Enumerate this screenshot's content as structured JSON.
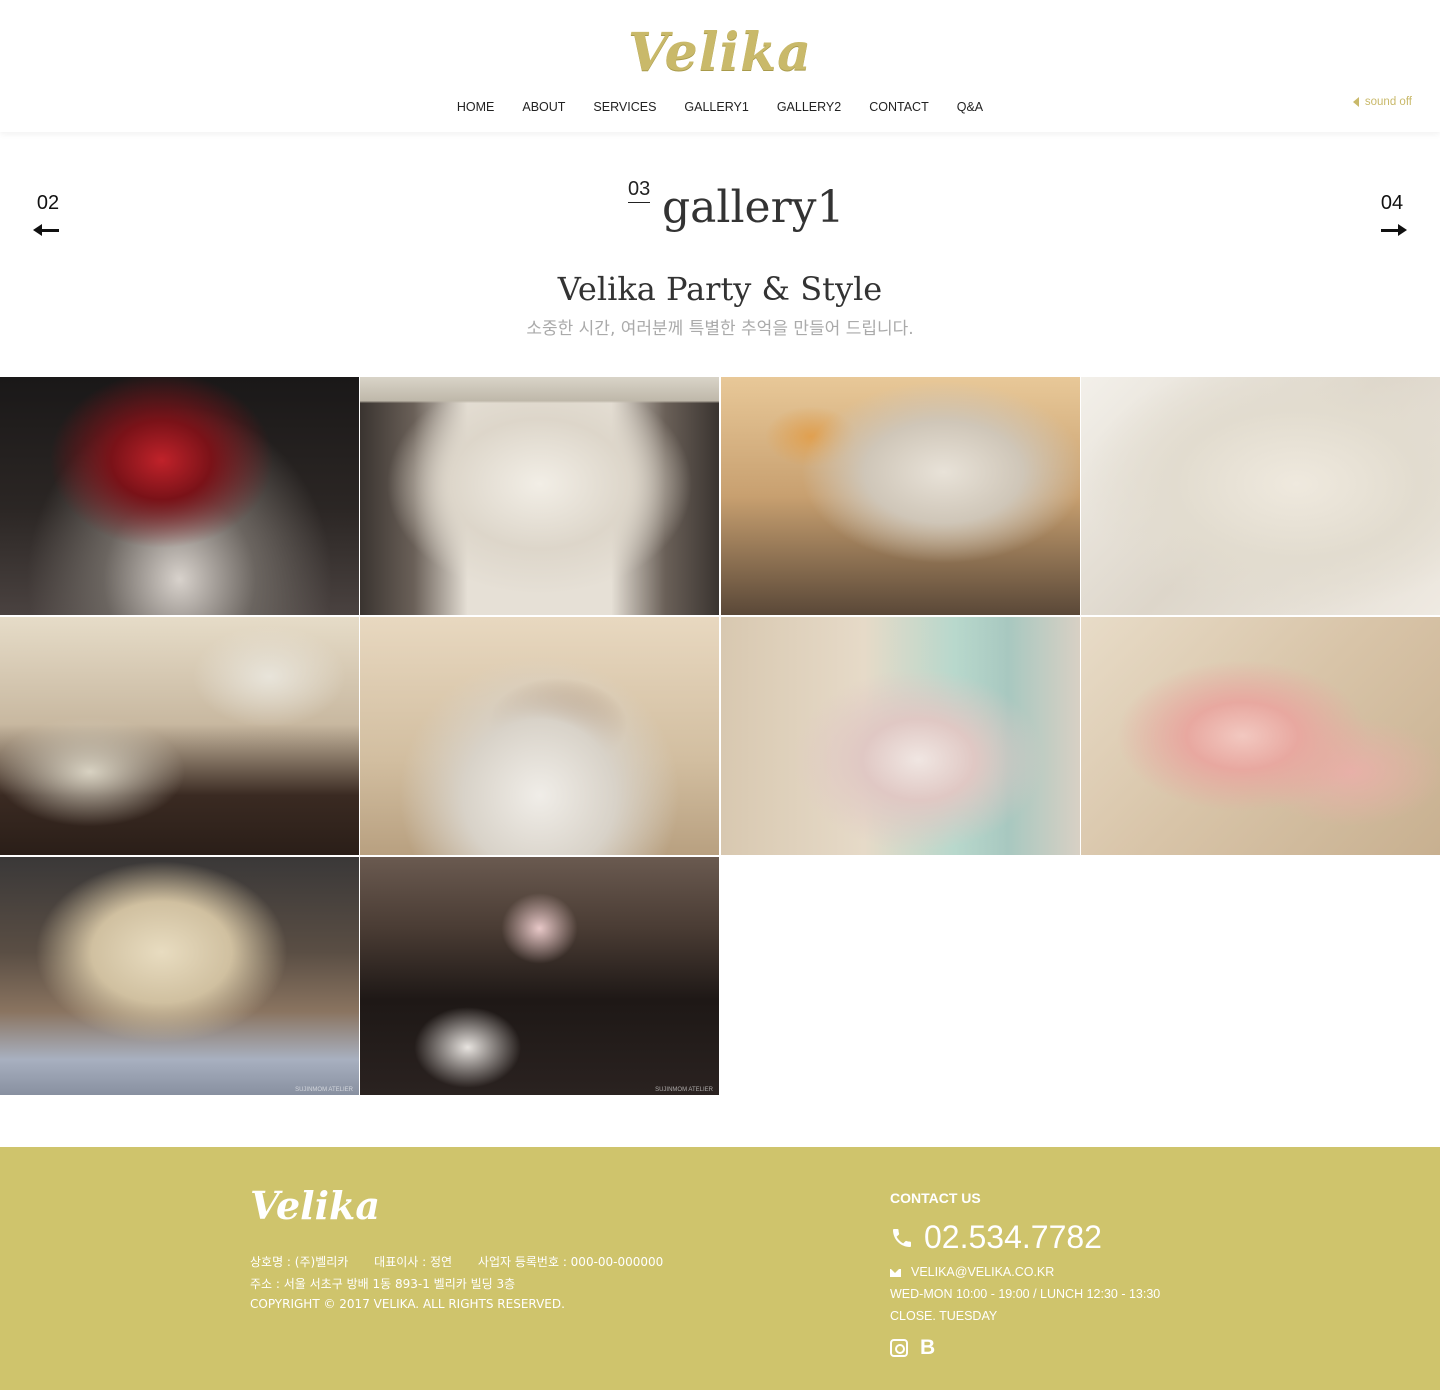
{
  "header": {
    "logo": "Velika",
    "nav": [
      "HOME",
      "ABOUT",
      "SERVICES",
      "GALLERY1",
      "GALLERY2",
      "CONTACT",
      "Q&A"
    ],
    "sound_label": "sound off"
  },
  "page_nav": {
    "prev": "02",
    "next": "04"
  },
  "section": {
    "number": "03",
    "title": "gallery1",
    "subtitle": "Velika Party & Style",
    "description": "소중한 시간, 여러분께 특별한 추억을 만들어 드립니다."
  },
  "gallery": {
    "watermark": "SUJINMOM ATELIER",
    "photos": [
      "Red berry centerpiece on dinner table",
      "White floral stage backdrop with dessert table",
      "Paper flower place card board with frames",
      "Celebrate first birthday paper flower sign",
      "Traditional Korean doljabi table items",
      "Rice cakes and fruit on gold stands",
      "Cherry blossom vase and butterfly candle",
      "Pink cherry blossom branches close-up",
      "Photo frames and folding screen display",
      "Dining tables with pink napkins and candles"
    ]
  },
  "footer": {
    "logo": "Velika",
    "company": "상호명 : (주)벨리카",
    "ceo": "대표이사 : 정연",
    "biz_no": "사업자 등록번호 : 000-00-000000",
    "address": "주소 : 서울 서초구 방배 1동 893-1 벨리카 빌딩 3층",
    "copyright": "COPYRIGHT © 2017 VELIKA. ALL RIGHTS RESERVED.",
    "contact_heading": "CONTACT US",
    "phone": "02.534.7782",
    "email": "VELIKA@VELIKA.CO.KR",
    "hours": "WED-MON 10:00 - 19:00 / LUNCH 12:30 - 13:30",
    "closed": "CLOSE. TUESDAY",
    "social": [
      "instagram-icon",
      "blog-icon"
    ]
  },
  "colors": {
    "accent": "#c9b96a",
    "footer_bg": "#cfc46c"
  }
}
